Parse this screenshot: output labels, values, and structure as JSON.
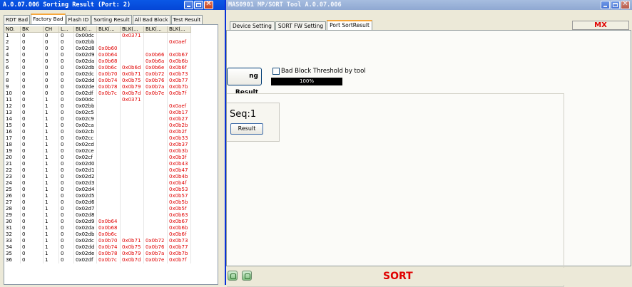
{
  "back_window": {
    "title": "MAS0901 MP/SORT Tool A.0.07.006",
    "mx_label": "MX",
    "tabs": [
      "Device Setting",
      "SORT FW Setting",
      "Port SortResult"
    ],
    "active_tab": 2,
    "sorting_result_button": "ng Result",
    "bad_block_checkbox_label": "Bad Block Threshold by tool",
    "progress_text": "100%",
    "progress": 1.0,
    "seq_label": "Seq:1",
    "result_button": "Result",
    "sort_label": "SORT"
  },
  "front_window": {
    "title": "A.0.07.006 Sorting Result (Port: 2)",
    "tabs": [
      "RDT Bad",
      "Factory Bad",
      "Flash ID",
      "Sorting Result",
      "All Bad Block",
      "Test Result"
    ],
    "active_tab": 1,
    "columns": [
      "NO.",
      "BK",
      "CH",
      "L...",
      "BLK(...",
      "BLK(...",
      "BLK(...",
      "BLK(...",
      "BLK(..."
    ],
    "rows": [
      [
        "1",
        "0",
        "0",
        "0",
        "0x00dc",
        "",
        "0x0371",
        "",
        ""
      ],
      [
        "2",
        "0",
        "0",
        "0",
        "0x02bb",
        "",
        "",
        "",
        "0x0aef"
      ],
      [
        "3",
        "0",
        "0",
        "0",
        "0x02d8",
        "0x0b60",
        "",
        "",
        ""
      ],
      [
        "4",
        "0",
        "0",
        "0",
        "0x02d9",
        "0x0b64",
        "",
        "0x0b66",
        "0x0b67"
      ],
      [
        "5",
        "0",
        "0",
        "0",
        "0x02da",
        "0x0b68",
        "",
        "0x0b6a",
        "0x0b6b"
      ],
      [
        "6",
        "0",
        "0",
        "0",
        "0x02db",
        "0x0b6c",
        "0x0b6d",
        "0x0b6e",
        "0x0b6f"
      ],
      [
        "7",
        "0",
        "0",
        "0",
        "0x02dc",
        "0x0b70",
        "0x0b71",
        "0x0b72",
        "0x0b73"
      ],
      [
        "8",
        "0",
        "0",
        "0",
        "0x02dd",
        "0x0b74",
        "0x0b75",
        "0x0b76",
        "0x0b77"
      ],
      [
        "9",
        "0",
        "0",
        "0",
        "0x02de",
        "0x0b78",
        "0x0b79",
        "0x0b7a",
        "0x0b7b"
      ],
      [
        "10",
        "0",
        "0",
        "0",
        "0x02df",
        "0x0b7c",
        "0x0b7d",
        "0x0b7e",
        "0x0b7f"
      ],
      [
        "11",
        "0",
        "1",
        "0",
        "0x00dc",
        "",
        "0x0371",
        "",
        ""
      ],
      [
        "12",
        "0",
        "1",
        "0",
        "0x02bb",
        "",
        "",
        "",
        "0x0aef"
      ],
      [
        "13",
        "0",
        "1",
        "0",
        "0x02c5",
        "",
        "",
        "",
        "0x0b17"
      ],
      [
        "14",
        "0",
        "1",
        "0",
        "0x02c9",
        "",
        "",
        "",
        "0x0b27"
      ],
      [
        "15",
        "0",
        "1",
        "0",
        "0x02ca",
        "",
        "",
        "",
        "0x0b2b"
      ],
      [
        "16",
        "0",
        "1",
        "0",
        "0x02cb",
        "",
        "",
        "",
        "0x0b2f"
      ],
      [
        "17",
        "0",
        "1",
        "0",
        "0x02cc",
        "",
        "",
        "",
        "0x0b33"
      ],
      [
        "18",
        "0",
        "1",
        "0",
        "0x02cd",
        "",
        "",
        "",
        "0x0b37"
      ],
      [
        "19",
        "0",
        "1",
        "0",
        "0x02ce",
        "",
        "",
        "",
        "0x0b3b"
      ],
      [
        "20",
        "0",
        "1",
        "0",
        "0x02cf",
        "",
        "",
        "",
        "0x0b3f"
      ],
      [
        "21",
        "0",
        "1",
        "0",
        "0x02d0",
        "",
        "",
        "",
        "0x0b43"
      ],
      [
        "22",
        "0",
        "1",
        "0",
        "0x02d1",
        "",
        "",
        "",
        "0x0b47"
      ],
      [
        "23",
        "0",
        "1",
        "0",
        "0x02d2",
        "",
        "",
        "",
        "0x0b4b"
      ],
      [
        "24",
        "0",
        "1",
        "0",
        "0x02d3",
        "",
        "",
        "",
        "0x0b4f"
      ],
      [
        "25",
        "0",
        "1",
        "0",
        "0x02d4",
        "",
        "",
        "",
        "0x0b53"
      ],
      [
        "26",
        "0",
        "1",
        "0",
        "0x02d5",
        "",
        "",
        "",
        "0x0b57"
      ],
      [
        "27",
        "0",
        "1",
        "0",
        "0x02d6",
        "",
        "",
        "",
        "0x0b5b"
      ],
      [
        "28",
        "0",
        "1",
        "0",
        "0x02d7",
        "",
        "",
        "",
        "0x0b5f"
      ],
      [
        "29",
        "0",
        "1",
        "0",
        "0x02d8",
        "",
        "",
        "",
        "0x0b63"
      ],
      [
        "30",
        "0",
        "1",
        "0",
        "0x02d9",
        "0x0b64",
        "",
        "",
        "0x0b67"
      ],
      [
        "31",
        "0",
        "1",
        "0",
        "0x02da",
        "0x0b68",
        "",
        "",
        "0x0b6b"
      ],
      [
        "32",
        "0",
        "1",
        "0",
        "0x02db",
        "0x0b6c",
        "",
        "",
        "0x0b6f"
      ],
      [
        "33",
        "0",
        "1",
        "0",
        "0x02dc",
        "0x0b70",
        "0x0b71",
        "0x0b72",
        "0x0b73"
      ],
      [
        "34",
        "0",
        "1",
        "0",
        "0x02dd",
        "0x0b74",
        "0x0b75",
        "0x0b76",
        "0x0b77"
      ],
      [
        "35",
        "0",
        "1",
        "0",
        "0x02de",
        "0x0b78",
        "0x0b79",
        "0x0b7a",
        "0x0b7b"
      ],
      [
        "36",
        "0",
        "1",
        "0",
        "0x02df",
        "0x0b7c",
        "0x0b7d",
        "0x0b7e",
        "0x0b7f"
      ]
    ]
  },
  "colors": {
    "front_title_bar": "#0546d6",
    "back_title_bar": "#8fa8d2",
    "block_text": "#e00000",
    "accent_red": "#e00000",
    "tab_highlight": "#f6a63a"
  },
  "icons": {
    "minimize": "minimize-icon",
    "maximize": "maximize-icon",
    "close": "close-icon",
    "title_app": "app-icon",
    "status_left": "green-square-icon",
    "status_right": "green-square-icon"
  }
}
